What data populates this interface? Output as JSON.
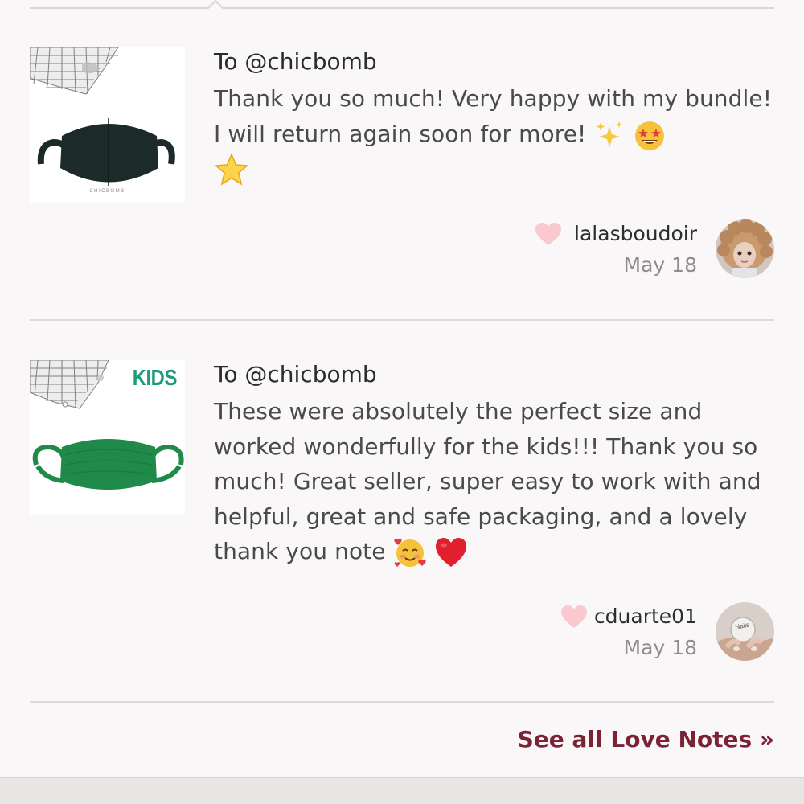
{
  "notes": [
    {
      "to": "To @chicbomb",
      "text": "Thank you so much! Very happy with my bundle! I will return again soon for more!",
      "author": "lalasboudoir",
      "date": "May 18",
      "product_brand": "CHICBOMB",
      "emojis": [
        "sparkles-emoji",
        "star-struck-emoji",
        "star-emoji"
      ]
    },
    {
      "to": "To @chicbomb",
      "text": "These were absolutely the perfect size and worked wonderfully for the kids!!! Thank you so much! Great seller, super easy to work with and helpful, great and safe packaging, and a lovely thank you note",
      "author": "cduarte01",
      "date": "May 18",
      "product_label": "KIDS",
      "emojis": [
        "smiling-face-with-hearts-emoji",
        "red-heart-emoji"
      ]
    }
  ],
  "see_all_label": "See all Love Notes »",
  "colors": {
    "accent": "#7b2335",
    "heart": "#f9c9cf",
    "kids_green": "#1a9c7d",
    "mask_green": "#1f8a4a",
    "mask_dark": "#1d2a2a"
  }
}
